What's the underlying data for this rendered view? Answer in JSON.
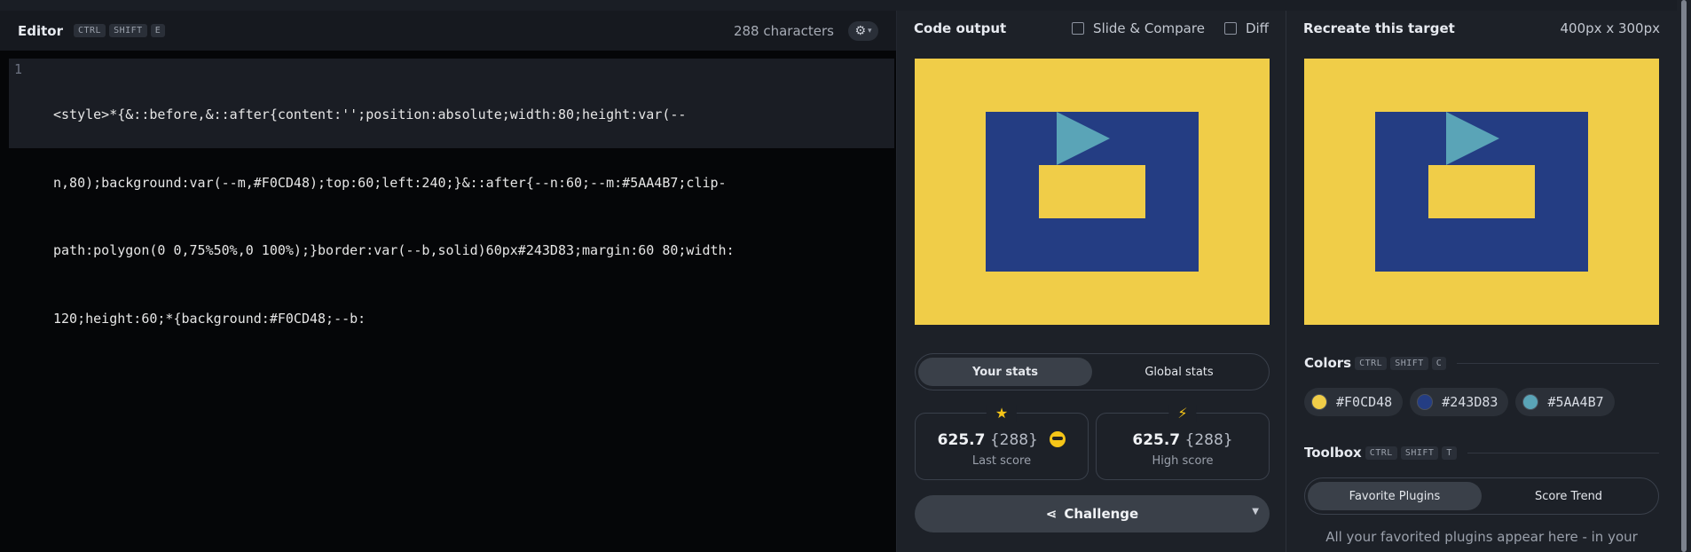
{
  "editor": {
    "title": "Editor",
    "shortcut": [
      "CTRL",
      "SHIFT",
      "E"
    ],
    "char_count": "288 characters",
    "line_number": "1",
    "code_lines": [
      "<style>*{&::before,&::after{content:'';position:absolute;width:80;height:var(--",
      "n,80);background:var(--m,#F0CD48);top:60;left:240;}&::after{--n:60;--m:#5AA4B7;clip-",
      "path:polygon(0 0,75%50%,0 100%);}border:var(--b,solid)60px#243D83;margin:60 80;width:",
      "120;height:60;*{background:#F0CD48;--b:"
    ]
  },
  "output": {
    "title": "Code output",
    "slide_compare_label": "Slide & Compare",
    "diff_label": "Diff",
    "stats_tabs": [
      "Your stats",
      "Global stats"
    ],
    "last_score": {
      "value": "625.7",
      "chars": "{288}",
      "label": "Last score"
    },
    "high_score": {
      "value": "625.7",
      "chars": "{288}",
      "label": "High score"
    },
    "challenge_label": "Challenge"
  },
  "target": {
    "title": "Recreate this target",
    "dims": "400px x 300px",
    "colors_title": "Colors",
    "colors_shortcut": [
      "CTRL",
      "SHIFT",
      "C"
    ],
    "colors": [
      {
        "hex": "#F0CD48",
        "swatch": "#F0CD48"
      },
      {
        "hex": "#243D83",
        "swatch": "#243D83"
      },
      {
        "hex": "#5AA4B7",
        "swatch": "#5AA4B7"
      }
    ],
    "toolbox_title": "Toolbox",
    "toolbox_shortcut": [
      "CTRL",
      "SHIFT",
      "T"
    ],
    "toolbox_tabs": [
      "Favorite Plugins",
      "Score Trend"
    ],
    "plugins_note": "All your favorited plugins appear here - in your"
  },
  "palette": {
    "yellow": "#F0CD48",
    "blue": "#243D83",
    "teal": "#5AA4B7"
  }
}
